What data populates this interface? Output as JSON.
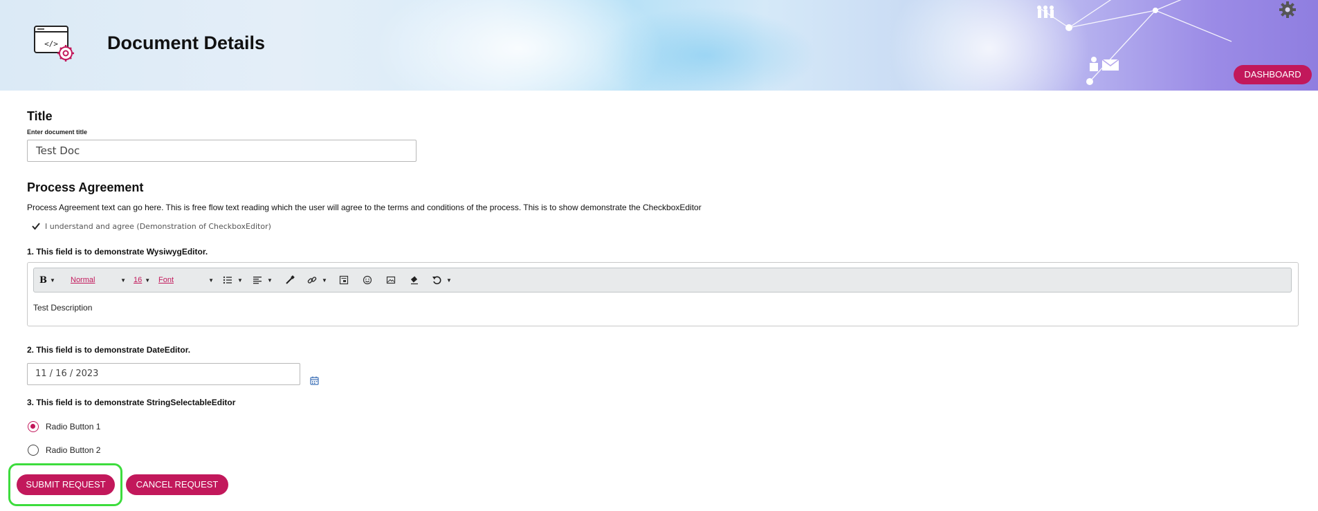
{
  "header": {
    "title": "Document Details",
    "dashboard_label": "DASHBOARD",
    "logo_icon": "code-window-gear-icon",
    "settings_icon": "gear-icon"
  },
  "title_section": {
    "heading": "Title",
    "label": "Enter document title",
    "value": "Test Doc"
  },
  "agreement": {
    "heading": "Process Agreement",
    "text": "Process Agreement text can go here. This is free flow text reading which the user will agree to the terms and conditions of the process. This is to show demonstrate the CheckboxEditor",
    "checkbox_label": "I understand and agree (Demonstration of CheckboxEditor)",
    "checked": true
  },
  "wysiwyg": {
    "label": "1. This field is to demonstrate WysiwygEditor.",
    "toolbar": {
      "bold": "B",
      "paragraph_format": "Normal",
      "font_size": "16",
      "font_family": "Font",
      "icons": [
        "bold-icon",
        "list-icon",
        "align-icon",
        "color-picker-icon",
        "link-icon",
        "embed-icon",
        "emoji-icon",
        "image-icon",
        "eraser-icon",
        "undo-icon"
      ]
    },
    "content": "Test Description"
  },
  "date": {
    "label": "2. This field is to demonstrate DateEditor.",
    "value": "11 / 16 / 2023"
  },
  "selectable": {
    "label": "3. This field is to demonstrate StringSelectableEditor",
    "options": [
      {
        "label": "Radio Button 1",
        "selected": true
      },
      {
        "label": "Radio Button 2",
        "selected": false
      }
    ]
  },
  "actions": {
    "submit_label": "SUBMIT REQUEST",
    "cancel_label": "CANCEL REQUEST"
  },
  "colors": {
    "accent": "#c2185b",
    "highlight": "#3ddc3d"
  }
}
